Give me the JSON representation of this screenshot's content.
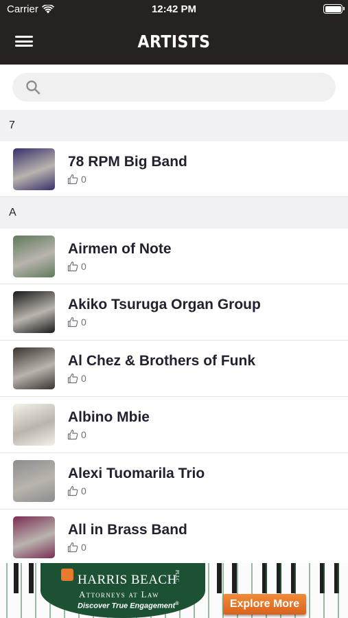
{
  "status_bar": {
    "carrier": "Carrier",
    "time": "12:42 PM"
  },
  "nav": {
    "title": "ARTISTS",
    "menu_icon": "hamburger-menu-icon"
  },
  "search": {
    "placeholder": "",
    "value": "",
    "icon": "search-icon"
  },
  "sections": [
    {
      "header": "7",
      "artists": [
        {
          "name": "78 RPM Big Band",
          "likes": "0",
          "thumb_color": "#3a2f6a"
        }
      ]
    },
    {
      "header": "A",
      "artists": [
        {
          "name": "Airmen of Note",
          "likes": "0",
          "thumb_color": "#5f7a5a"
        },
        {
          "name": "Akiko Tsuruga Organ Group",
          "likes": "0",
          "thumb_color": "#1a1a1a"
        },
        {
          "name": "Al Chez & Brothers of Funk",
          "likes": "0",
          "thumb_color": "#3a3430"
        },
        {
          "name": "Albino Mbie",
          "likes": "0",
          "thumb_color": "#f4f0ea"
        },
        {
          "name": "Alexi Tuomarila Trio",
          "likes": "0",
          "thumb_color": "#8d8d8d"
        },
        {
          "name": "All in Brass Band",
          "likes": "0",
          "thumb_color": "#7b2d55"
        }
      ]
    }
  ],
  "ad": {
    "brand": "HARRIS BEACH",
    "brand_suffix": "PLLC",
    "subtitle": "Attorneys at Law",
    "tagline": "Discover True Engagement",
    "tagline_mark": "®",
    "cta": "Explore More",
    "colors": {
      "brand_green": "#1c5133",
      "cta_orange": "#e67a2e"
    }
  },
  "colors": {
    "navbar": "#272222",
    "section_header": "#f1f1f3",
    "text": "#21212f"
  }
}
